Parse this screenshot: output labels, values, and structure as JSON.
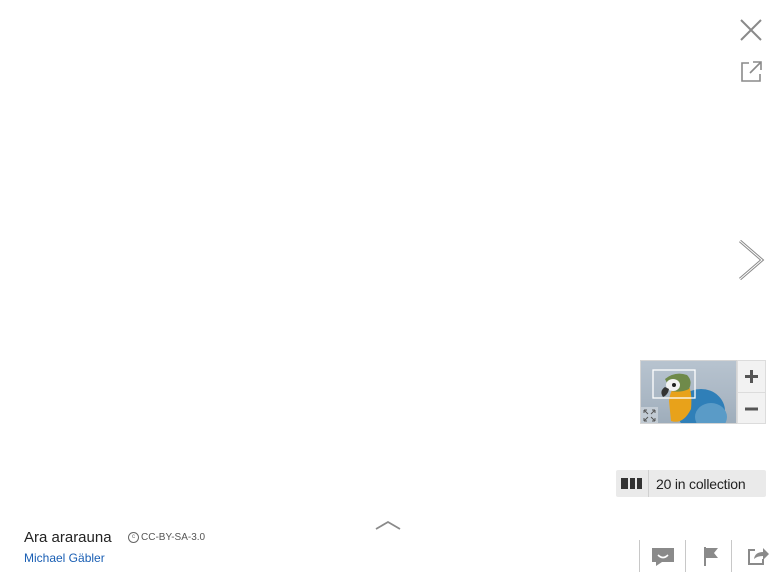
{
  "viewer": {
    "close_icon": "close-icon",
    "fullscreen_icon": "open-in-new-window-icon",
    "next_icon": "chevron-right-icon",
    "details_toggle_icon": "chevron-up-icon"
  },
  "zoom": {
    "plus_icon": "plus-icon",
    "minus_icon": "minus-icon",
    "fit_icon": "fit-to-screen-icon"
  },
  "collection": {
    "icon": "grid-icon",
    "label": "20 in collection"
  },
  "image_info": {
    "title": "Ara ararauna",
    "license_icon": "cc-icon",
    "license": "CC-BY-SA-3.0",
    "author": "Michael Gäbler"
  },
  "actions": {
    "comment_icon": "comment-icon",
    "flag_icon": "flag-icon",
    "share_icon": "share-icon"
  }
}
